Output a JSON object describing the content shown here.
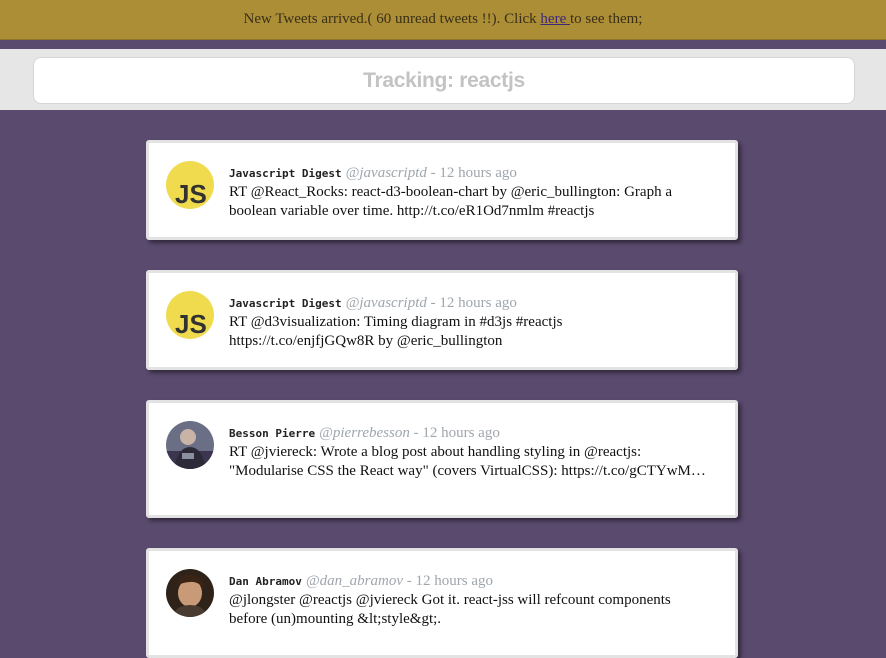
{
  "notification": {
    "before": "New Tweets arrived.( 60 unread tweets !!). Click ",
    "link": "here ",
    "after": " to see them;"
  },
  "header": {
    "title": "Tracking: reactjs"
  },
  "tweets": [
    {
      "name": "Javascript Digest",
      "handle": "@javascriptd",
      "separator": " - ",
      "time": "12 hours ago",
      "text": "RT @React_Rocks: react-d3-boolean-chart by @eric_bullington: Graph a boolean variable over time. http://t.co/eR1Od7nmlm #reactjs",
      "avatar": "js-logo"
    },
    {
      "name": "Javascript Digest",
      "handle": "@javascriptd",
      "separator": " - ",
      "time": "12 hours ago",
      "text": "RT @d3visualization: Timing diagram in #d3js #reactjs https://t.co/enjfjGQw8R by @eric_bullington",
      "avatar": "js-logo"
    },
    {
      "name": "Besson Pierre",
      "handle": "@pierrebesson",
      "separator": " - ",
      "time": "12 hours ago",
      "text": "RT @jviereck: Wrote a blog post about handling styling in @reactjs: \"Modularise CSS the React way\" (covers VirtualCSS): https://t.co/gCTYwM…",
      "avatar": "photo-person"
    },
    {
      "name": "Dan Abramov",
      "handle": "@dan_abramov",
      "separator": " - ",
      "time": "12 hours ago",
      "text": "@jlongster @reactjs @jviereck Got it. react-jss will refcount components before (un)mounting &lt;style&gt;.",
      "avatar": "photo-person"
    }
  ],
  "js_logo": {
    "label": "JS",
    "bg_color": "#f0db4f",
    "fg_color": "#323330"
  },
  "colors": {
    "background": "#5a4a6e",
    "notification_bar": "#ac8e36",
    "header_band": "#e6e6e6"
  }
}
